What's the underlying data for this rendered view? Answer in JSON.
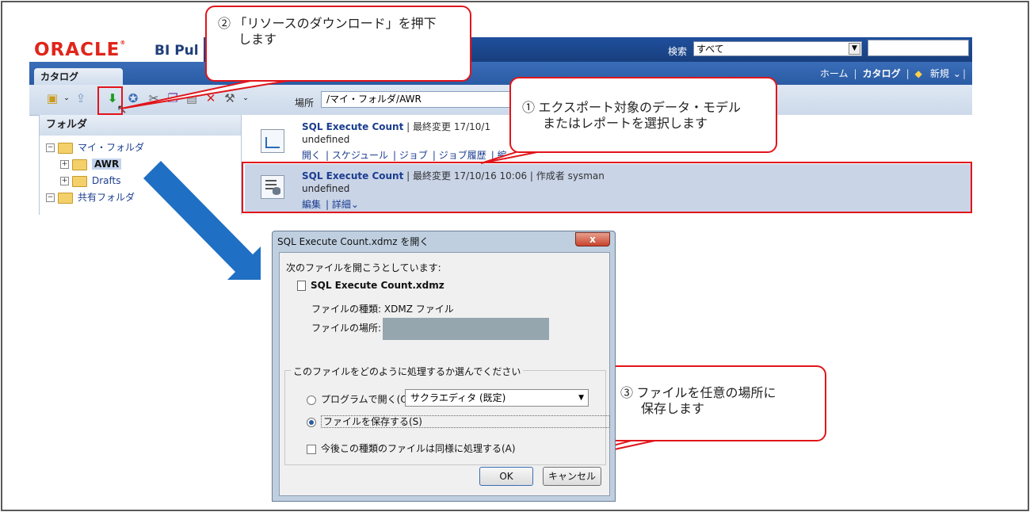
{
  "app": {
    "brand": "ORACLE",
    "product": "BI Pul",
    "search_label": "検索",
    "search_scope": "すべて",
    "catalog_tab": "カタログ",
    "top_links": [
      "ホーム",
      "カタログ",
      "新規"
    ],
    "location_label": "場所",
    "location_path": "/マイ・フォルダ/AWR"
  },
  "sidebar": {
    "header": "フォルダ",
    "tree": [
      {
        "label": "マイ・フォルダ",
        "sign": "⊟"
      },
      {
        "label": "AWR",
        "sign": "⊞"
      },
      {
        "label": "Drafts",
        "sign": "⊞"
      },
      {
        "label": "共有フォルダ",
        "sign": "⊟"
      }
    ]
  },
  "items": [
    {
      "title": "SQL Execute Count",
      "meta": "| 最終変更 17/10/1",
      "desc": "undefined",
      "links": [
        "開く",
        "| スケジュール",
        "| ジョブ",
        "| ジョブ履歴",
        "| 編"
      ]
    },
    {
      "title": "SQL Execute Count",
      "meta": "| 最終変更 17/10/16 10:06 | 作成者 sysman",
      "desc": "undefined",
      "links": [
        "編集",
        "| 詳細"
      ]
    }
  ],
  "callouts": {
    "c1_line1": "① エクスポート対象のデータ・モデル",
    "c1_line2": "またはレポートを選択します",
    "c2_line1": "② 「リソースのダウンロード」を押下",
    "c2_line2": "します",
    "c3_line1": "③ ファイルを任意の場所に",
    "c3_line2": "保存します"
  },
  "dialog": {
    "title": "SQL Execute Count.xdmz を開く",
    "close": "x",
    "intro": "次のファイルを開こうとしています:",
    "filename": "SQL Execute Count.xdmz",
    "type_label": "ファイルの種類:",
    "type_value": "XDMZ ファイル",
    "location_label": "ファイルの場所:",
    "question": "このファイルをどのように処理するか選んでください",
    "open_with_label": "プログラムで開く(O):",
    "open_with_value": "サクラエディタ (既定)",
    "save_label": "ファイルを保存する(S)",
    "remember_label": "今後この種類のファイルは同様に処理する(A)",
    "ok": "OK",
    "cancel": "キャンセル"
  },
  "colors": {
    "accent_red": "#e1151b",
    "arrow_blue": "#1f6fc4",
    "oracle_red": "#e0251b",
    "nav_blue": "#2a5ba4"
  }
}
